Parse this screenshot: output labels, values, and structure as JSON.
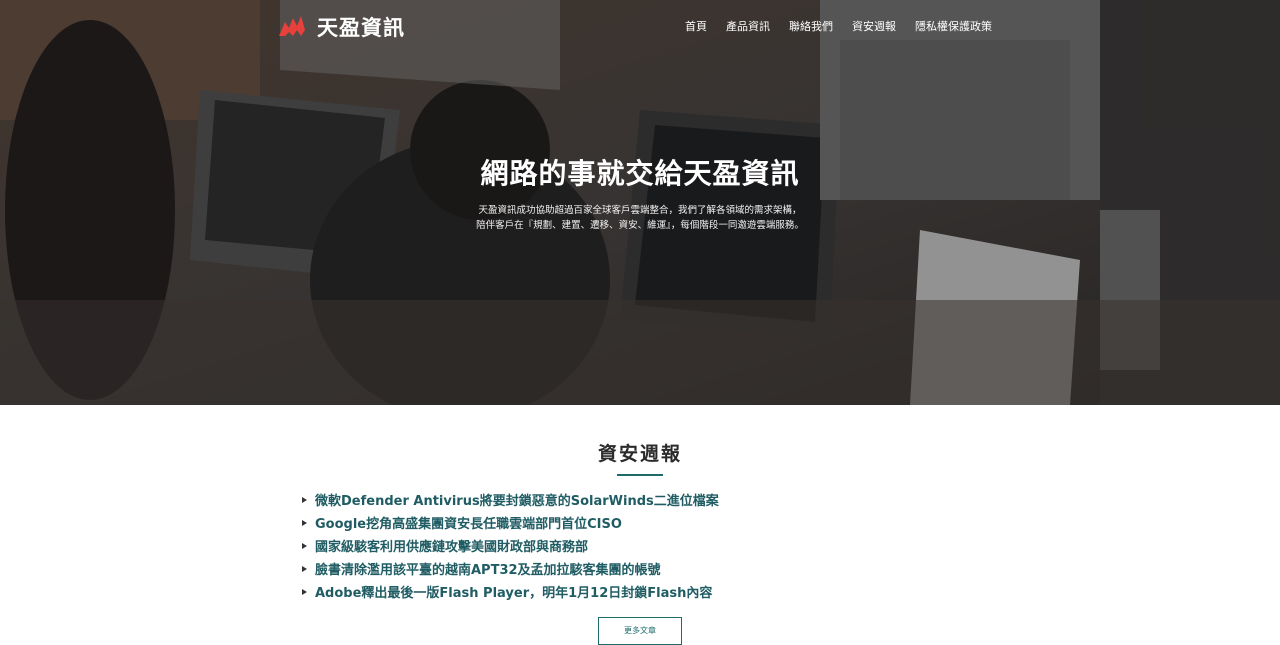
{
  "brand": {
    "name": "天盈資訊",
    "accent": "#e8403a"
  },
  "nav": {
    "items": [
      "首頁",
      "產品資訊",
      "聯絡我們",
      "資安週報",
      "隱私權保護政策"
    ]
  },
  "hero": {
    "title": "網路的事就交給天盈資訊",
    "desc_line1": "天盈資訊成功協助超過百家全球客戶雲端整合，我們了解各領域的需求架構，",
    "desc_line2": "陪伴客戶在『規劃、建置、遷移、資安、維運』，每個階段一同邀遊雲端服務。"
  },
  "news": {
    "title": "資安週報",
    "items": [
      "微軟Defender Antivirus將要封鎖惡意的SolarWinds二進位檔案",
      "Google挖角高盛集團資安長任職雲端部門首位CISO",
      "國家級駭客利用供應鏈攻擊美國財政部與商務部",
      "臉書清除濫用該平臺的越南APT32及孟加拉駭客集團的帳號",
      "Adobe釋出最後一版Flash Player，明年1月12日封鎖Flash內容"
    ],
    "more_label": "更多文章",
    "link_color": "#1f5c63"
  }
}
